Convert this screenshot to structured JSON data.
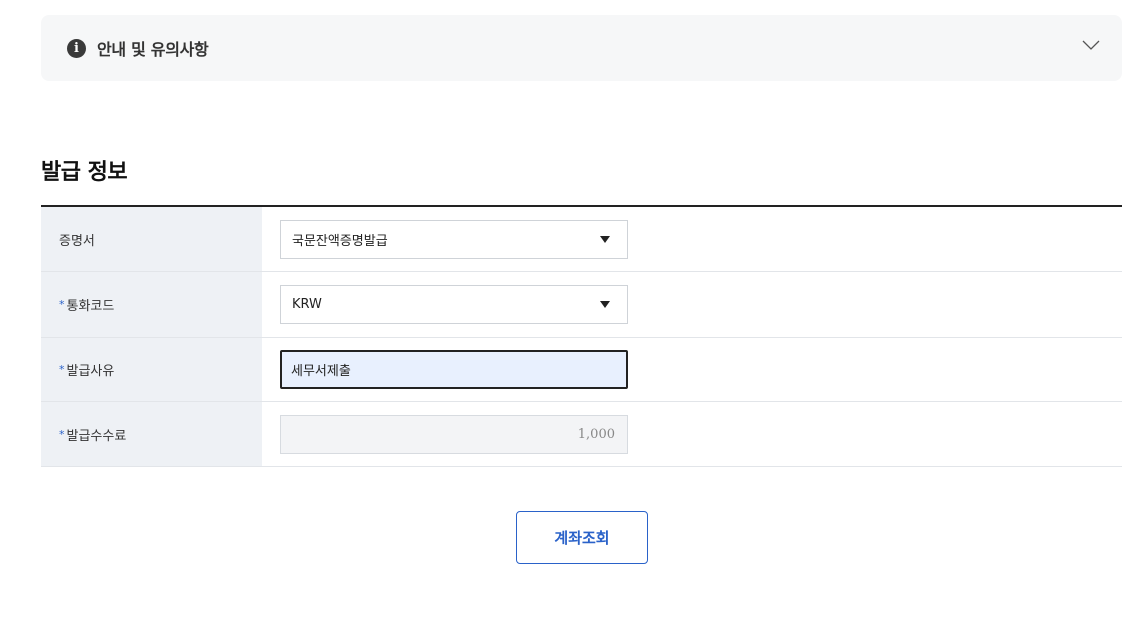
{
  "notice": {
    "title": "안내 및 유의사항",
    "icon": "info-icon",
    "icon_glyph": "i"
  },
  "section": {
    "title": "발급 정보"
  },
  "form": {
    "required_mark": "*",
    "rows": [
      {
        "label": "증명서",
        "required": false,
        "value": "국문잔액증명발급"
      },
      {
        "label": "통화코드",
        "required": true,
        "value": "KRW"
      },
      {
        "label": "발급사유",
        "required": true,
        "value": "세무서제출"
      },
      {
        "label": "발급수수료",
        "required": true,
        "value": "1,000"
      }
    ]
  },
  "actions": {
    "submit_label": "계좌조회"
  },
  "colors": {
    "accent": "#2a62c9",
    "label_bg": "#eef1f5",
    "notice_bg": "#f6f7f8"
  }
}
